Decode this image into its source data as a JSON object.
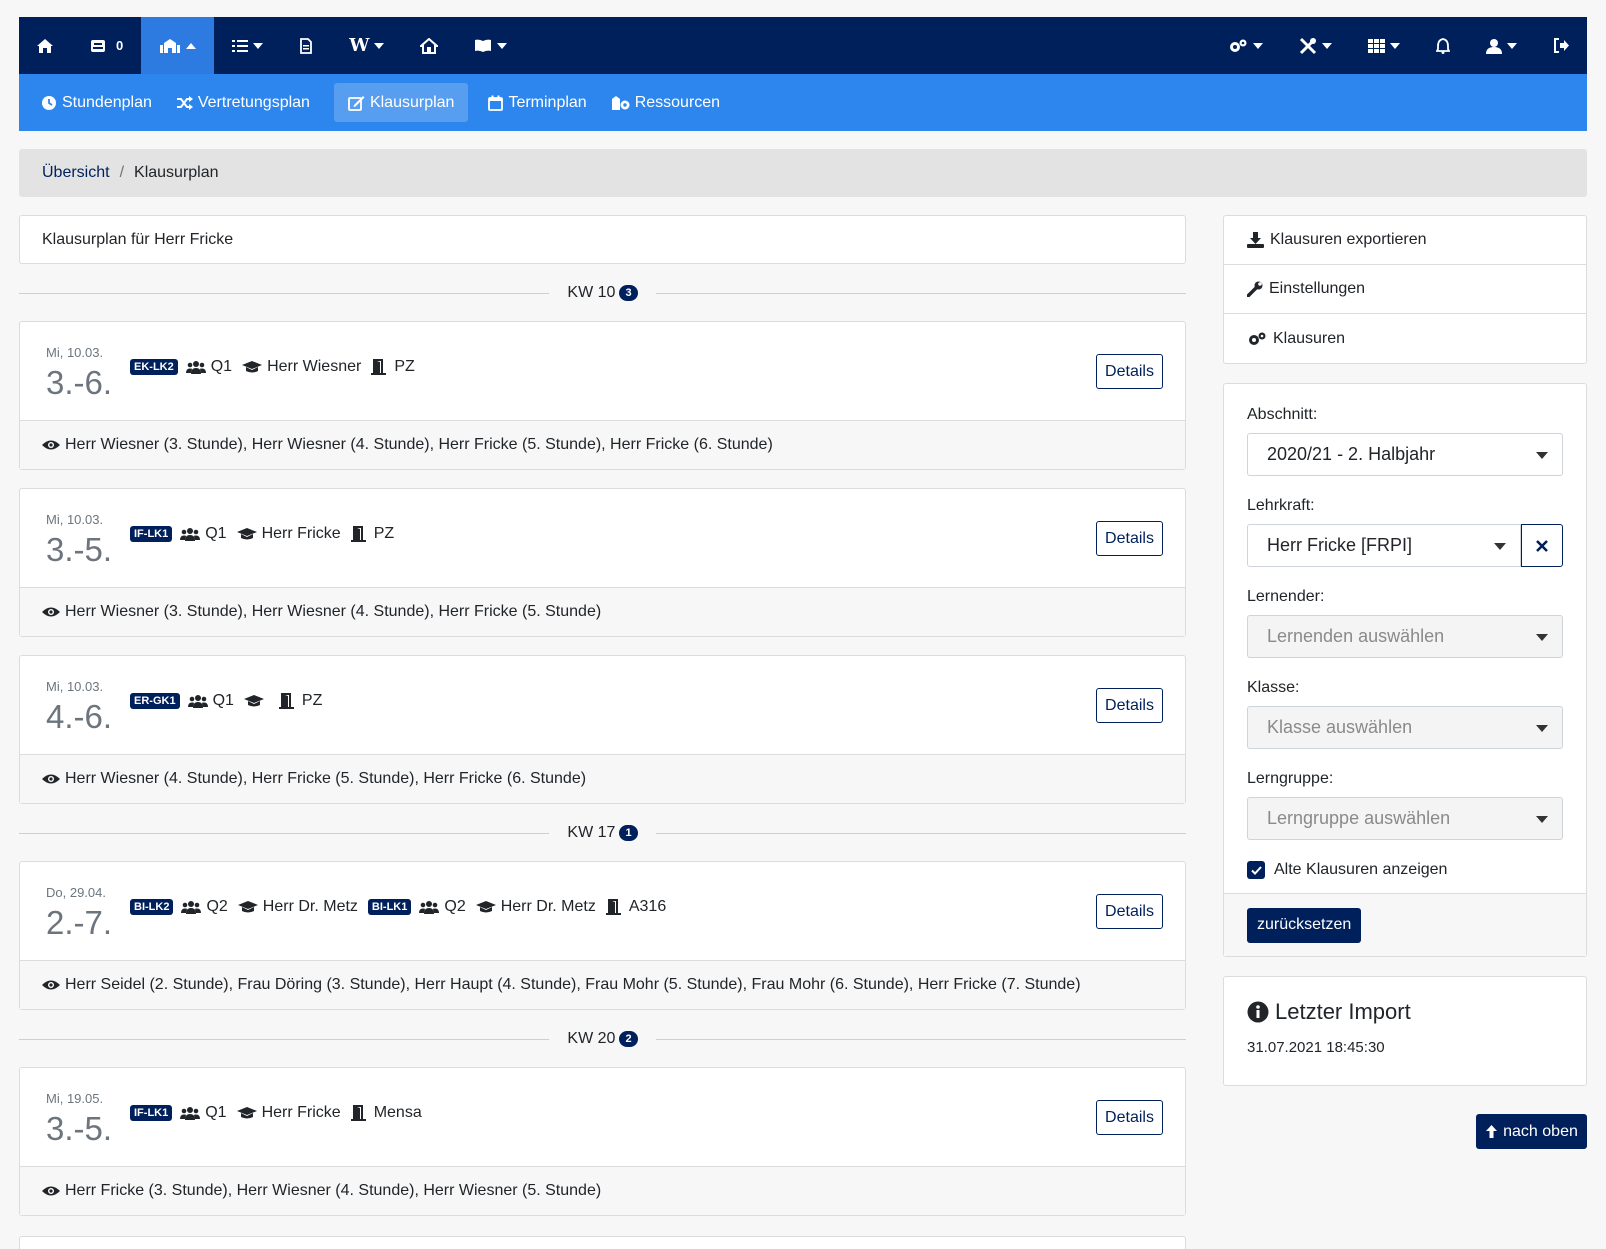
{
  "topnav": {
    "badge_count": "0",
    "icons": [
      "home-icon",
      "inbox-icon",
      "school-icon",
      "list-icon",
      "document-icon",
      "wiki-icon",
      "house-icon",
      "book-icon",
      "cogs-icon",
      "tools-icon",
      "grid-icon",
      "bell-icon",
      "user-icon",
      "sign-out-icon"
    ]
  },
  "subnav": {
    "items": [
      {
        "label": "Stundenplan",
        "icon": "clock-icon"
      },
      {
        "label": "Vertretungsplan",
        "icon": "shuffle-icon"
      },
      {
        "label": "Klausurplan",
        "icon": "edit-icon",
        "active": true
      },
      {
        "label": "Terminplan",
        "icon": "calendar-icon"
      },
      {
        "label": "Ressourcen",
        "icon": "resources-icon"
      }
    ]
  },
  "breadcrumb": {
    "home": "Übersicht",
    "sep": "/",
    "current": "Klausurplan"
  },
  "main": {
    "title": "Klausurplan für Herr Fricke",
    "weeks": [
      {
        "label": "KW 10",
        "count": "3"
      },
      {
        "label": "KW 17",
        "count": "1"
      },
      {
        "label": "KW 20",
        "count": "2"
      }
    ],
    "exams": [
      {
        "date": "Mi, 10.03.",
        "hours": "3.-6.",
        "tag": "EK-LK2",
        "group": "Q1",
        "teacher": "Herr Wiesner",
        "room": "PZ",
        "details": "Details",
        "supervision": "Herr Wiesner (3. Stunde), Herr Wiesner (4. Stunde), Herr Fricke (5. Stunde), Herr Fricke (6. Stunde)"
      },
      {
        "date": "Mi, 10.03.",
        "hours": "3.-5.",
        "tag": "IF-LK1",
        "group": "Q1",
        "teacher": "Herr Fricke",
        "room": "PZ",
        "details": "Details",
        "supervision": "Herr Wiesner (3. Stunde), Herr Wiesner (4. Stunde), Herr Fricke (5. Stunde)"
      },
      {
        "date": "Mi, 10.03.",
        "hours": "4.-6.",
        "tag": "ER-GK1",
        "group": "Q1",
        "teacher": "",
        "room": "PZ",
        "details": "Details",
        "supervision": "Herr Wiesner (4. Stunde), Herr Fricke (5. Stunde), Herr Fricke (6. Stunde)"
      },
      {
        "date": "Do, 29.04.",
        "hours": "2.-7.",
        "tag": "BI-LK2",
        "group": "Q2",
        "teacher": "Herr Dr. Metz",
        "tag2": "BI-LK1",
        "group2": "Q2",
        "teacher2": "Herr Dr. Metz",
        "room": "A316",
        "details": "Details",
        "supervision": "Herr Seidel (2. Stunde), Frau Döring (3. Stunde), Herr Haupt (4. Stunde), Frau Mohr (5. Stunde), Frau Mohr (6. Stunde), Herr Fricke (7. Stunde)"
      },
      {
        "date": "Mi, 19.05.",
        "hours": "3.-5.",
        "tag": "IF-LK1",
        "group": "Q1",
        "teacher": "Herr Fricke",
        "room": "Mensa",
        "details": "Details",
        "supervision": "Herr Fricke (3. Stunde), Herr Wiesner (4. Stunde), Herr Wiesner (5. Stunde)"
      }
    ]
  },
  "sidebar": {
    "actions": [
      "Klausuren exportieren",
      "Einstellungen",
      "Klausuren"
    ],
    "filter": {
      "section_label": "Abschnitt:",
      "section_value": "2020/21 - 2. Halbjahr",
      "teacher_label": "Lehrkraft:",
      "teacher_value": "Herr Fricke [FRPI]",
      "student_label": "Lernender:",
      "student_placeholder": "Lernenden auswählen",
      "class_label": "Klasse:",
      "class_placeholder": "Klasse auswählen",
      "group_label": "Lerngruppe:",
      "group_placeholder": "Lerngruppe auswählen",
      "old_label": "Alte Klausuren anzeigen",
      "old_checked": true,
      "reset": "zurücksetzen"
    },
    "import": {
      "title": "Letzter Import",
      "timestamp": "31.07.2021 18:45:30"
    }
  },
  "back_to_top": "nach oben",
  "colors": {
    "navy": "#00205b",
    "blue": "#2d86ee"
  }
}
